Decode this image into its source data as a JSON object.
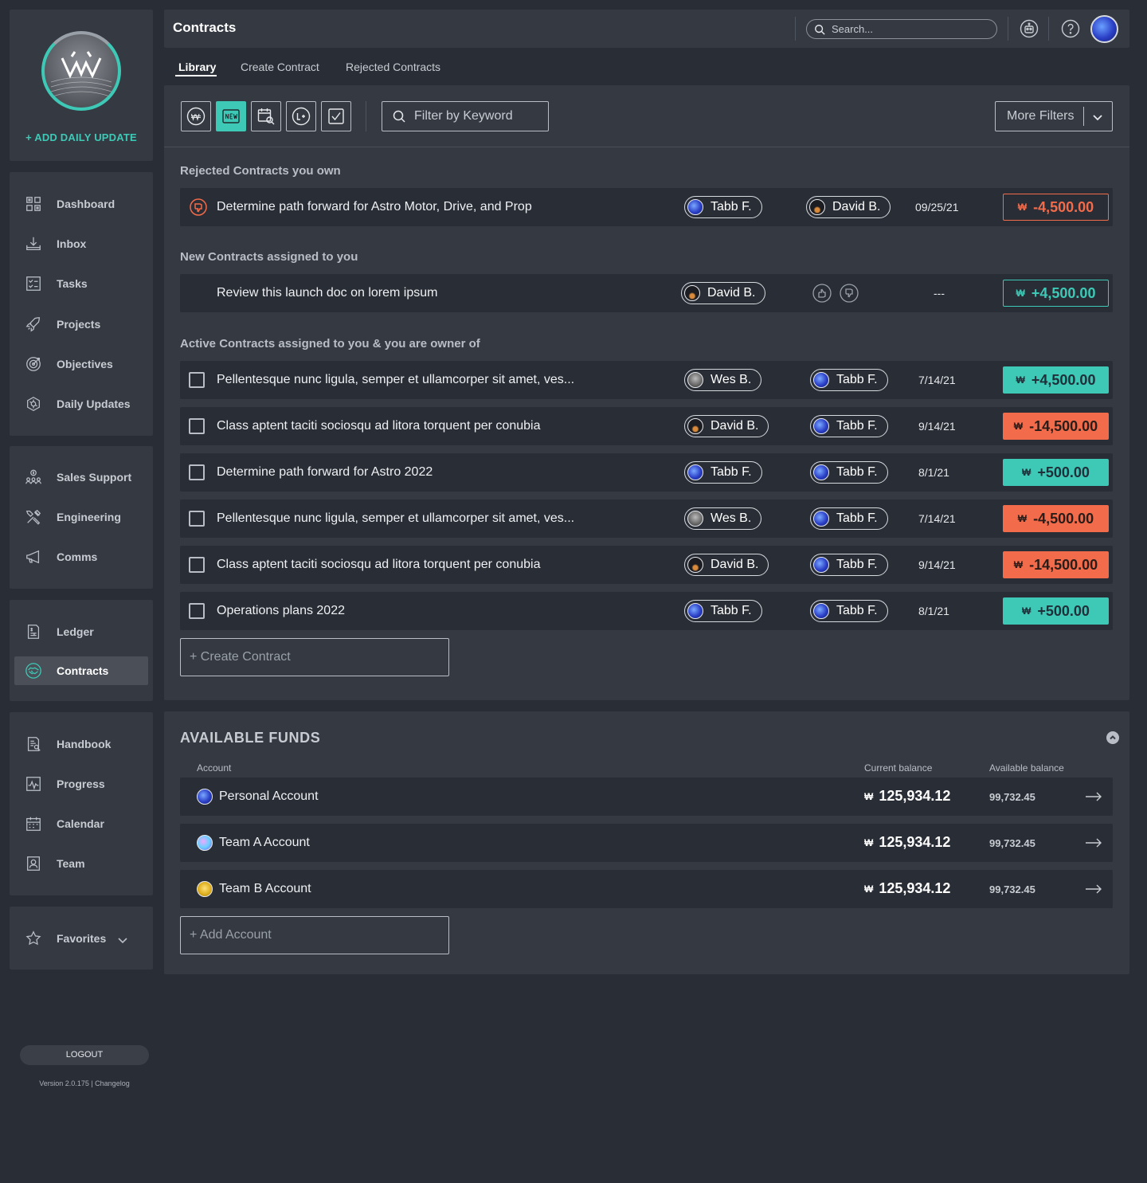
{
  "sidebar": {
    "add_update": "+ ADD DAILY UPDATE",
    "group1": [
      {
        "label": "Dashboard",
        "icon": "dashboard-icon"
      },
      {
        "label": "Inbox",
        "icon": "inbox-icon"
      },
      {
        "label": "Tasks",
        "icon": "tasks-icon"
      },
      {
        "label": "Projects",
        "icon": "rocket-icon"
      },
      {
        "label": "Objectives",
        "icon": "target-icon"
      },
      {
        "label": "Daily Updates",
        "icon": "daily-updates-icon"
      }
    ],
    "group2": [
      {
        "label": "Sales Support",
        "icon": "sales-icon"
      },
      {
        "label": "Engineering",
        "icon": "tools-icon"
      },
      {
        "label": "Comms",
        "icon": "megaphone-icon"
      }
    ],
    "group3": [
      {
        "label": "Ledger",
        "icon": "ledger-icon"
      },
      {
        "label": "Contracts",
        "icon": "handshake-icon",
        "active": true
      }
    ],
    "group4": [
      {
        "label": "Handbook",
        "icon": "handbook-icon"
      },
      {
        "label": "Progress",
        "icon": "progress-icon"
      },
      {
        "label": "Calendar",
        "icon": "calendar-icon"
      },
      {
        "label": "Team",
        "icon": "team-icon"
      }
    ],
    "favorites": "Favorites",
    "logout": "LOGOUT",
    "version": "Version 2.0.175 | Changelog"
  },
  "header": {
    "title": "Contracts",
    "search_placeholder": "Search..."
  },
  "tabs": [
    "Library",
    "Create Contract",
    "Rejected Contracts"
  ],
  "toolbar": {
    "filter_placeholder": "Filter by Keyword",
    "more_filters": "More Filters"
  },
  "sections": {
    "rejected": "Rejected Contracts you own",
    "new": "New Contracts assigned to you",
    "active": "Active Contracts assigned to you & you are owner of"
  },
  "currency_symbol": "₩",
  "rejected_row": {
    "title": "Determine path forward for Astro Motor, Drive, and Prop",
    "owner": "Tabb F.",
    "assignee": "David B.",
    "date": "09/25/21",
    "amount": "-4,500.00"
  },
  "new_row": {
    "title": "Review this launch doc on lorem ipsum",
    "owner": "David B.",
    "date": "---",
    "amount": "+4,500.00"
  },
  "active_rows": [
    {
      "title": "Pellentesque nunc ligula, semper et ullamcorper sit amet, ves...",
      "owner": "Wes B.",
      "assignee": "Tabb F.",
      "date": "7/14/21",
      "amount": "+4,500.00",
      "kind": "pos"
    },
    {
      "title": "Class aptent taciti sociosqu ad litora torquent per conubia",
      "owner": "David B.",
      "assignee": "Tabb F.",
      "date": "9/14/21",
      "amount": "-14,500.00",
      "kind": "neg"
    },
    {
      "title": "Determine path forward for Astro 2022",
      "owner": "Tabb F.",
      "assignee": "Tabb F.",
      "date": "8/1/21",
      "amount": "+500.00",
      "kind": "pos"
    },
    {
      "title": "Pellentesque nunc ligula, semper et ullamcorper sit amet, ves...",
      "owner": "Wes B.",
      "assignee": "Tabb F.",
      "date": "7/14/21",
      "amount": "-4,500.00",
      "kind": "neg"
    },
    {
      "title": "Class aptent taciti sociosqu ad litora torquent per conubia",
      "owner": "David B.",
      "assignee": "Tabb F.",
      "date": "9/14/21",
      "amount": "-14,500.00",
      "kind": "neg"
    },
    {
      "title": "Operations plans 2022",
      "owner": "Tabb F.",
      "assignee": "Tabb F.",
      "date": "8/1/21",
      "amount": "+500.00",
      "kind": "pos"
    }
  ],
  "create_contract": "+ Create Contract",
  "funds": {
    "title": "AVAILABLE FUNDS",
    "col_account": "Account",
    "col_current": "Current balance",
    "col_available": "Available balance",
    "accounts": [
      {
        "name": "Personal Account",
        "current": "125,934.12",
        "available": "99,732.45"
      },
      {
        "name": "Team A Account",
        "current": "125,934.12",
        "available": "99,732.45"
      },
      {
        "name": "Team B Account",
        "current": "125,934.12",
        "available": "99,732.45"
      }
    ],
    "add_account": "+ Add Account"
  },
  "colors": {
    "accent": "#3ec9b6",
    "negative": "#f26b4a",
    "panel": "#343942",
    "bg": "#292d35"
  }
}
